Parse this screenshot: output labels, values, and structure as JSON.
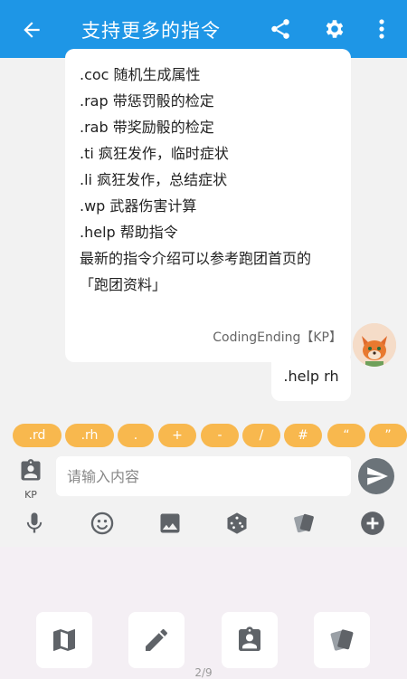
{
  "appbar": {
    "title": "支持更多的指令"
  },
  "chat": {
    "incoming_lines": [
      ".coc 随机生成属性",
      ".rap 带惩罚骰的检定",
      ".rab 带奖励骰的检定",
      ".ti 疯狂发作，临时症状",
      ".li 疯狂发作，总结症状",
      ".wp 武器伤害计算",
      ".help 帮助指令",
      "最新的指令介绍可以参考跑团首页的",
      "「跑团资料」"
    ],
    "outgoing_sender": "CodingEnding【KP】",
    "outgoing_text": ".help rh"
  },
  "quick_chips": [
    ".rd",
    ".rh",
    ".",
    "+",
    "-",
    "/",
    "#",
    "“",
    "”"
  ],
  "input": {
    "role_label": "KP",
    "placeholder": "请输入内容"
  },
  "toolbar": {
    "icons": [
      "mic-icon",
      "emoji-icon",
      "image-icon",
      "dice-icon",
      "cards-icon",
      "add-icon"
    ]
  },
  "panel": {
    "tiles": [
      "map-icon",
      "pencil-icon",
      "badge-icon",
      "cards-icon"
    ],
    "pager": "2/9"
  },
  "colors": {
    "appbar": "#1e96e6",
    "chip": "#f8b84e",
    "send": "#6b7379",
    "panel": "#f4eff4"
  }
}
